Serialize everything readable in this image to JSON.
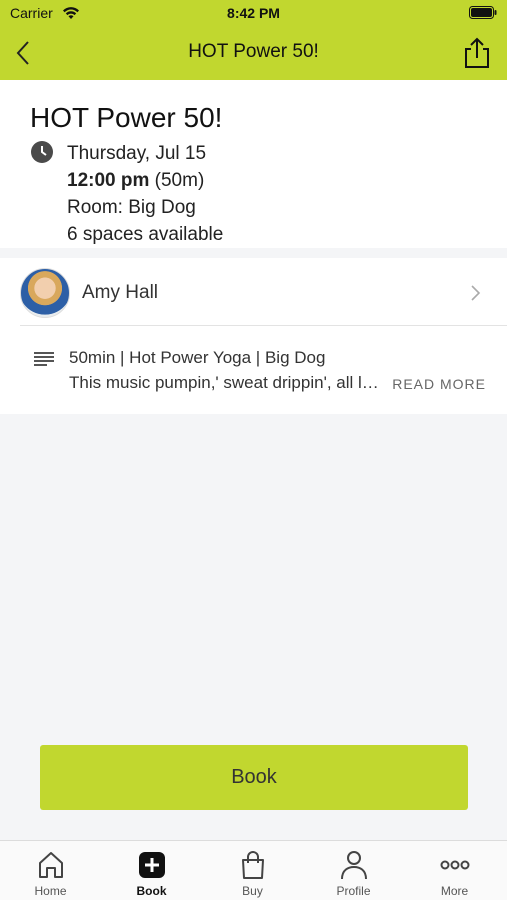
{
  "status_bar": {
    "carrier": "Carrier",
    "time": "8:42 PM"
  },
  "nav": {
    "title": "HOT Power 50!"
  },
  "class": {
    "title": "HOT Power 50!",
    "date": "Thursday, Jul 15",
    "time": "12:00 pm",
    "duration": "(50m)",
    "room": "Room: Big Dog",
    "spaces": "6 spaces available"
  },
  "instructor": {
    "name": "Amy Hall"
  },
  "description": {
    "title": "50min | Hot Power Yoga | Big Dog",
    "text": "This music pumpin,' sweat drippin', all levels class...",
    "read_more": "READ MORE"
  },
  "book_button": {
    "label": "Book"
  },
  "tabbar": {
    "items": [
      {
        "label": "Home",
        "icon": "home-icon"
      },
      {
        "label": "Book",
        "icon": "plus-square-icon",
        "active": true
      },
      {
        "label": "Buy",
        "icon": "shopping-bag-icon"
      },
      {
        "label": "Profile",
        "icon": "person-icon"
      },
      {
        "label": "More",
        "icon": "more-dots-icon"
      }
    ]
  },
  "colors": {
    "accent": "#c1d72f",
    "background": "#f4f5f7"
  }
}
